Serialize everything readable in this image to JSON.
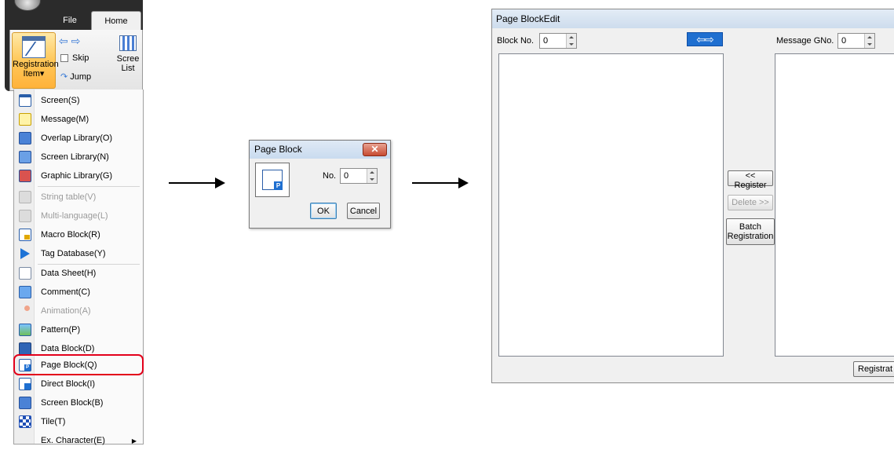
{
  "ribbon": {
    "tabs": [
      "File",
      "Home"
    ],
    "registration_item": "Registration\nItem▾",
    "registration_item_line1": "Registration",
    "registration_item_line2": "Item▾",
    "skip_label": "Skip",
    "jump_label": "Jump",
    "screen_list_line1": "Scree",
    "screen_list_line2": "List"
  },
  "menu": {
    "items": [
      {
        "label": "Screen(S)",
        "icon": "screen-icon",
        "enabled": true
      },
      {
        "label": "Message(M)",
        "icon": "message-icon",
        "enabled": true
      },
      {
        "label": "Overlap Library(O)",
        "icon": "overlap-library-icon",
        "enabled": true
      },
      {
        "label": "Screen Library(N)",
        "icon": "screen-library-icon",
        "enabled": true
      },
      {
        "label": "Graphic Library(G)",
        "icon": "graphic-library-icon",
        "enabled": true
      },
      {
        "label": "String table(V)",
        "icon": "string-table-icon",
        "enabled": false
      },
      {
        "label": "Multi-language(L)",
        "icon": "multi-language-icon",
        "enabled": false
      },
      {
        "label": "Macro Block(R)",
        "icon": "macro-block-icon",
        "enabled": true
      },
      {
        "label": "Tag Database(Y)",
        "icon": "flag-icon",
        "enabled": true
      },
      {
        "label": "Data Sheet(H)",
        "icon": "data-sheet-icon",
        "enabled": true
      },
      {
        "label": "Comment(C)",
        "icon": "comment-icon",
        "enabled": true
      },
      {
        "label": "Animation(A)",
        "icon": "animation-icon",
        "enabled": false
      },
      {
        "label": "Pattern(P)",
        "icon": "pattern-icon",
        "enabled": true
      },
      {
        "label": "Data Block(D)",
        "icon": "data-block-icon",
        "enabled": true
      },
      {
        "label": "Page Block(Q)",
        "icon": "page-block-icon",
        "enabled": true,
        "highlighted": true
      },
      {
        "label": "Direct Block(I)",
        "icon": "direct-block-icon",
        "enabled": true
      },
      {
        "label": "Screen Block(B)",
        "icon": "screen-block-icon",
        "enabled": true
      },
      {
        "label": "Tile(T)",
        "icon": "tile-icon",
        "enabled": true
      },
      {
        "label": "Ex. Character(E)",
        "icon": "",
        "enabled": true,
        "submenu": true
      }
    ]
  },
  "dialog": {
    "title": "Page Block",
    "close_glyph": "✕",
    "no_label": "No.",
    "no_value": "0",
    "ok_label": "OK",
    "cancel_label": "Cancel"
  },
  "editor": {
    "title": "Page BlockEdit",
    "block_no_label": "Block No.",
    "block_no_value": "0",
    "message_gno_label": "Message  GNo.",
    "message_gno_value": "0",
    "register_label": "<< Register",
    "delete_label": "Delete >>",
    "batch_line1": "Batch",
    "batch_line2": "Registration",
    "registration_button_label": "Registrat"
  },
  "colors": {
    "highlight": "#e3001b",
    "title_bar": "#cddced",
    "accent_blue": "#1f6fd0"
  }
}
